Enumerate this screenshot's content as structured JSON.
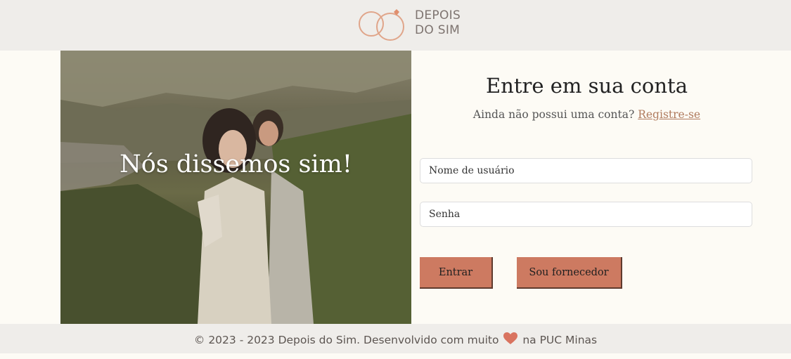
{
  "header": {
    "logo_line1": "DEPOIS",
    "logo_line2": "DO SIM",
    "logo_icon": "wedding-rings-icon"
  },
  "hero": {
    "title": "Nós dissemos sim!"
  },
  "login": {
    "title": "Entre em sua conta",
    "subtitle": "Ainda não possui uma conta?",
    "register_link": "Registre-se",
    "username_placeholder": "Nome de usuário",
    "password_placeholder": "Senha",
    "login_button": "Entrar",
    "supplier_button": "Sou fornecedor"
  },
  "footer": {
    "text_before": "© 2023 - 2023 Depois do Sim. Desenvolvido com muito",
    "heart_icon": "heart-icon",
    "text_after": "na PUC Minas"
  },
  "colors": {
    "header_bg": "#efedea",
    "page_bg": "#fdfbf5",
    "accent": "#cd7a61",
    "link": "#b07b5e",
    "logo": "#e0a58a"
  }
}
